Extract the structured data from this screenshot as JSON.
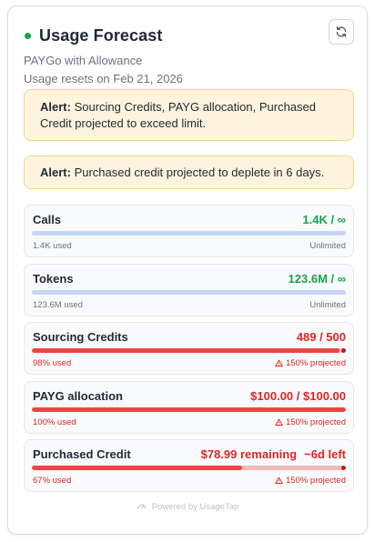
{
  "header": {
    "title": "Usage Forecast",
    "plan": "PAYGo with Allowance",
    "reset": "Usage resets on Feb 21, 2026",
    "status_color": "#16a34a",
    "refresh_icon": "refresh-icon"
  },
  "alerts": [
    {
      "prefix": "Alert:",
      "text": " Sourcing Credits, PAYG allocation, Purchased Credit projected to exceed limit."
    },
    {
      "prefix": "Alert:",
      "text": " Purchased credit projected to deplete in 6 days."
    }
  ],
  "meters": [
    {
      "label": "Calls",
      "value": "1.4K / ∞",
      "left": "1.4K used",
      "right": "Unlimited",
      "fill": 1.0,
      "state": "unlimited"
    },
    {
      "label": "Tokens",
      "value": "123.6M / ∞",
      "left": "123.6M used",
      "right": "Unlimited",
      "fill": 1.0,
      "state": "unlimited"
    },
    {
      "label": "Sourcing Credits",
      "value": "489 / 500",
      "left": "98% used",
      "right": "150% projected",
      "fill": 0.98,
      "state": "warning"
    },
    {
      "label": "PAYG allocation",
      "value": "$100.00 / $100.00",
      "left": "100% used",
      "right": "150% projected",
      "fill": 1.0,
      "state": "warning"
    },
    {
      "label": "Purchased Credit",
      "value": "$78.99 remaining",
      "value_extra": "~6d left",
      "left": "67% used",
      "right": "150% projected",
      "fill": 0.67,
      "state": "warning"
    }
  ],
  "footer": {
    "text": "Powered by UsageTap"
  },
  "colors": {
    "unlimited_bar": "#c7d7f3",
    "warning_bar": "#ef4444",
    "warning_track": "#f4b9b9",
    "green": "#16a34a",
    "red": "#dc2626"
  }
}
